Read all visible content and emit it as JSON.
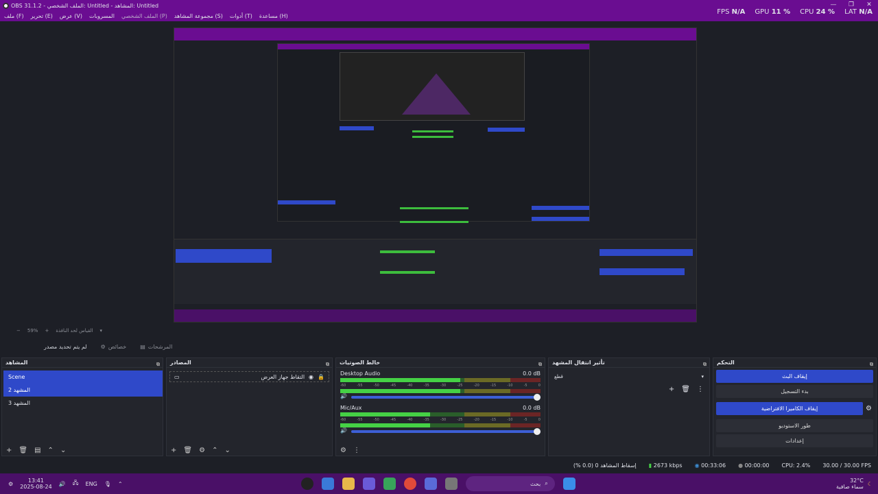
{
  "window": {
    "title": "OBS 31.1.2 - الملف الشخصي: Untitled - المشاهد: Untitled"
  },
  "menu": {
    "items": [
      "ملف (F)",
      "تحرير (E)",
      "عرض (V)",
      "المسروبات",
      "الملف الشخصي (P)",
      "مجموعة المشاهد (S)",
      "أدوات (T)",
      "مساعدة (H)"
    ]
  },
  "stats": {
    "fps_label": "FPS",
    "fps": "N/A",
    "gpu_label": "GPU",
    "gpu": "11 %",
    "cpu_label": "CPU",
    "cpu": "24 %",
    "lat_label": "LAT",
    "lat": "N/A"
  },
  "zoom": {
    "value": "59%",
    "label": "القياس لحد النافذة"
  },
  "toolbar": {
    "no_source": "لم يتم تحديد مصدر",
    "properties": "خصائص",
    "filters": "المرشحات"
  },
  "docks": {
    "scenes": {
      "title": "المشاهد",
      "items": [
        "Scene",
        "المشهد 2",
        "المشهد 3"
      ]
    },
    "sources": {
      "title": "المصادر",
      "items": [
        "التقاط جهاز العرض"
      ]
    },
    "mixer": {
      "title": "خالط الصوتيات",
      "channels": [
        {
          "name": "Desktop Audio",
          "db": "0.0 dB",
          "level": 0.6
        },
        {
          "name": "Mic/Aux",
          "db": "0.0 dB",
          "level": 0.45
        }
      ],
      "ticks": [
        "-60",
        "-55",
        "-50",
        "-45",
        "-40",
        "-35",
        "-30",
        "-25",
        "-20",
        "-15",
        "-10",
        "-5",
        "0"
      ]
    },
    "transitions": {
      "title": "تأثير انتقال المشهد",
      "selected": "قطع"
    },
    "controls": {
      "title": "التحكم",
      "buttons": [
        "إيقاف البث",
        "بدء التسجيل",
        "إيقاف الكاميرا الافتراضية",
        "طور الاستوديو",
        "إعدادات"
      ]
    }
  },
  "status": {
    "frames": "إسقاط المشاهد 0 (0.0 %)",
    "bitrate": "2673 kbps",
    "stream_time": "00:33:06",
    "rec_time": "00:00:00",
    "cpu": "CPU: 2.4%",
    "fps": "30.00 / 30.00 FPS"
  },
  "taskbar": {
    "time": "13:41",
    "date": "2025-08-24",
    "lang": "ENG",
    "search": "بحث",
    "weather_temp": "32°C",
    "weather_desc": "سماء صافية"
  },
  "colors": {
    "accent": "#6a0d91",
    "selection": "#2f49c9",
    "meter_green": "#45d145"
  }
}
